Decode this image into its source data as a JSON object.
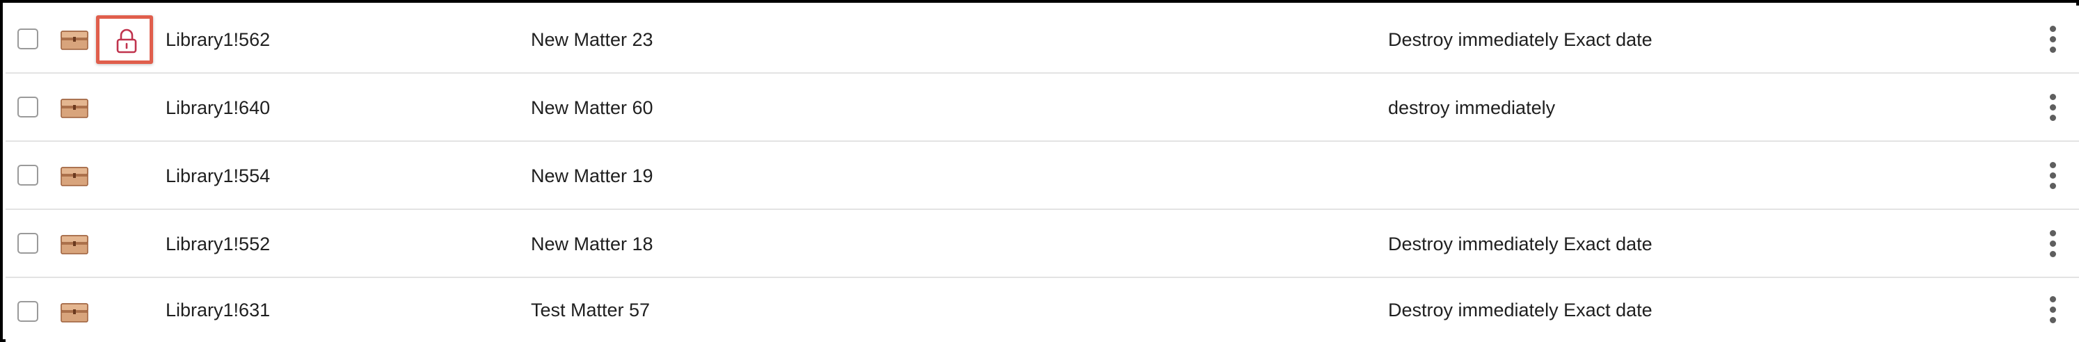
{
  "rows": [
    {
      "id": "Library1!562",
      "name": "New Matter 23",
      "policy": "Destroy immediately Exact date",
      "locked": true,
      "checked": false
    },
    {
      "id": "Library1!640",
      "name": "New Matter 60",
      "policy": "destroy immediately",
      "locked": false,
      "checked": false
    },
    {
      "id": "Library1!554",
      "name": "New Matter 19",
      "policy": "",
      "locked": false,
      "checked": false
    },
    {
      "id": "Library1!552",
      "name": "New Matter 18",
      "policy": "Destroy immediately Exact date",
      "locked": false,
      "checked": false
    },
    {
      "id": "Library1!631",
      "name": "Test Matter 57",
      "policy": "Destroy immediately Exact date",
      "locked": false,
      "checked": false
    }
  ],
  "icons": {
    "folder": "briefcase-folder-icon",
    "lock": "lock-icon",
    "row_menu": "more-vertical-icon"
  },
  "colors": {
    "folder_fill": "#d8a47c",
    "folder_stroke": "#9c5e3a",
    "lock_highlight_border": "#e05e4c",
    "lock_icon": "#c0334d",
    "row_divider": "#e3e3e3",
    "kebab": "#5e5e5e"
  }
}
